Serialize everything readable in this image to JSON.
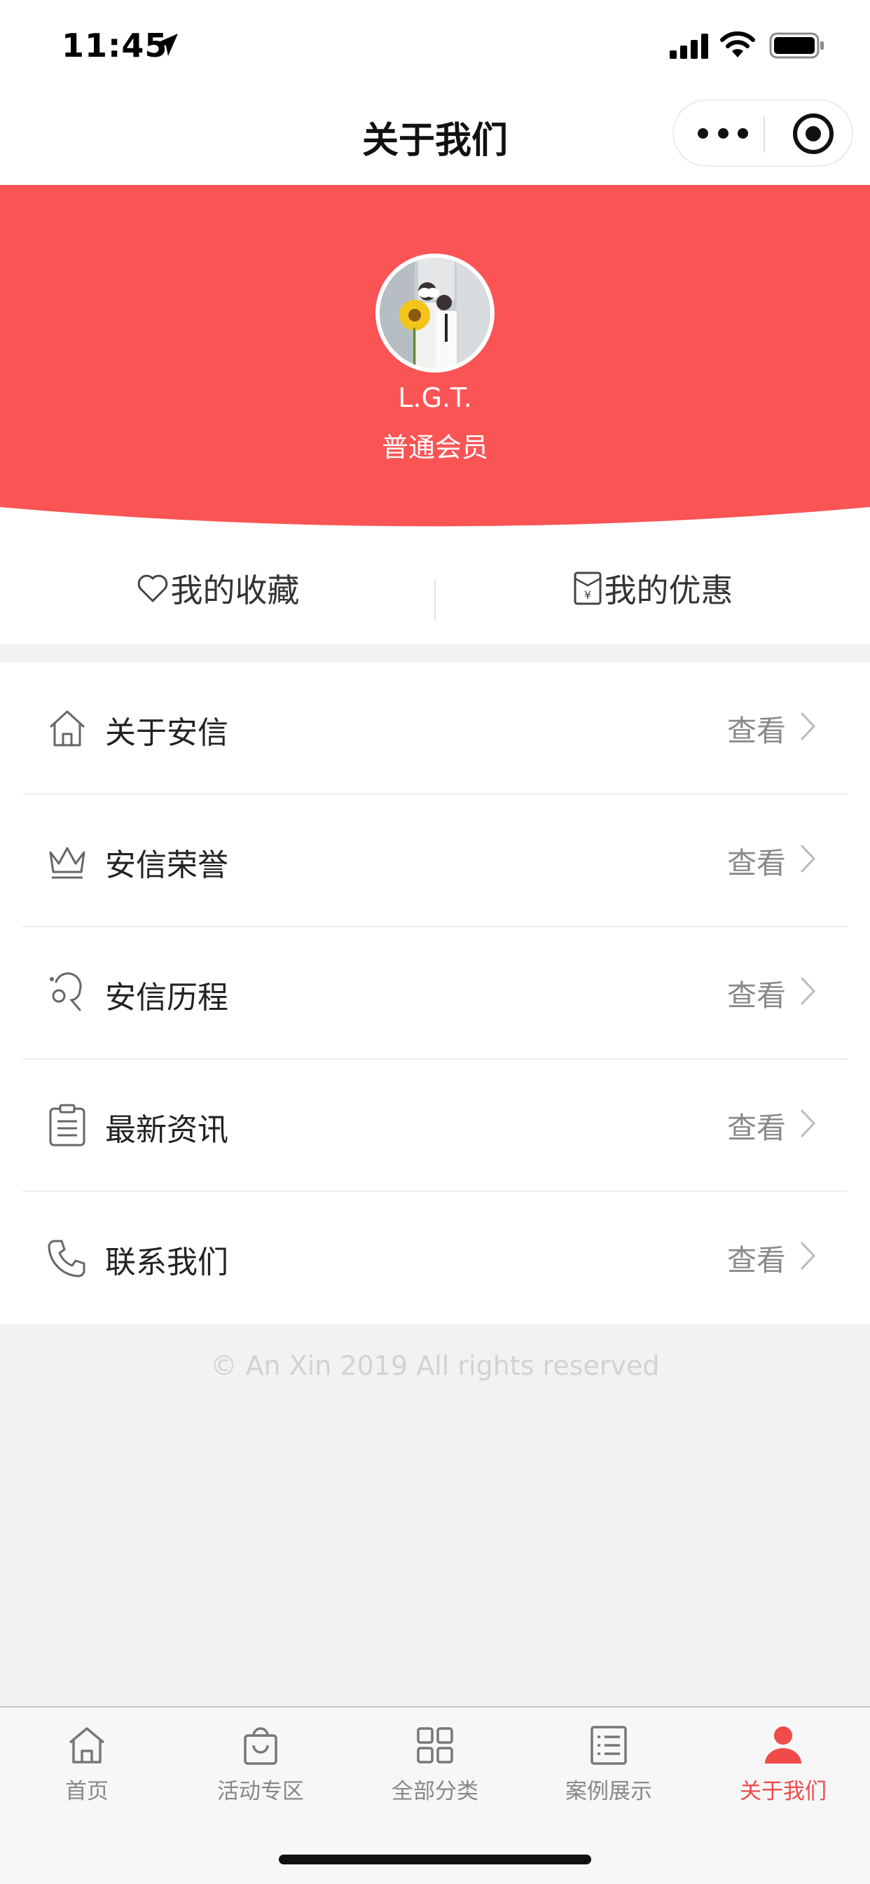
{
  "status_bar": {
    "time": "11:45"
  },
  "nav": {
    "title": "关于我们"
  },
  "profile": {
    "name": "L.G.T.",
    "level": "普通会员"
  },
  "quick_actions": [
    {
      "label": "我的收藏",
      "icon": "heart-icon"
    },
    {
      "label": "我的优惠",
      "icon": "coupon-icon"
    }
  ],
  "menu": [
    {
      "label": "关于安信",
      "action": "查看",
      "icon": "home-outline-icon"
    },
    {
      "label": "安信荣誉",
      "action": "查看",
      "icon": "crown-icon"
    },
    {
      "label": "安信历程",
      "action": "查看",
      "icon": "route-icon"
    },
    {
      "label": "最新资讯",
      "action": "查看",
      "icon": "clipboard-icon"
    },
    {
      "label": "联系我们",
      "action": "查看",
      "icon": "phone-icon"
    }
  ],
  "footer": {
    "copyright": "© An Xin 2019 All rights reserved"
  },
  "tabs": [
    {
      "label": "首页",
      "icon": "home-icon"
    },
    {
      "label": "活动专区",
      "icon": "shopping-bag-icon"
    },
    {
      "label": "全部分类",
      "icon": "grid-icon"
    },
    {
      "label": "案例展示",
      "icon": "list-icon"
    },
    {
      "label": "关于我们",
      "icon": "user-icon"
    }
  ],
  "colors": {
    "brand_red": "#fb5454",
    "tab_active": "#f04b4b",
    "tab_inactive": "#888888"
  }
}
